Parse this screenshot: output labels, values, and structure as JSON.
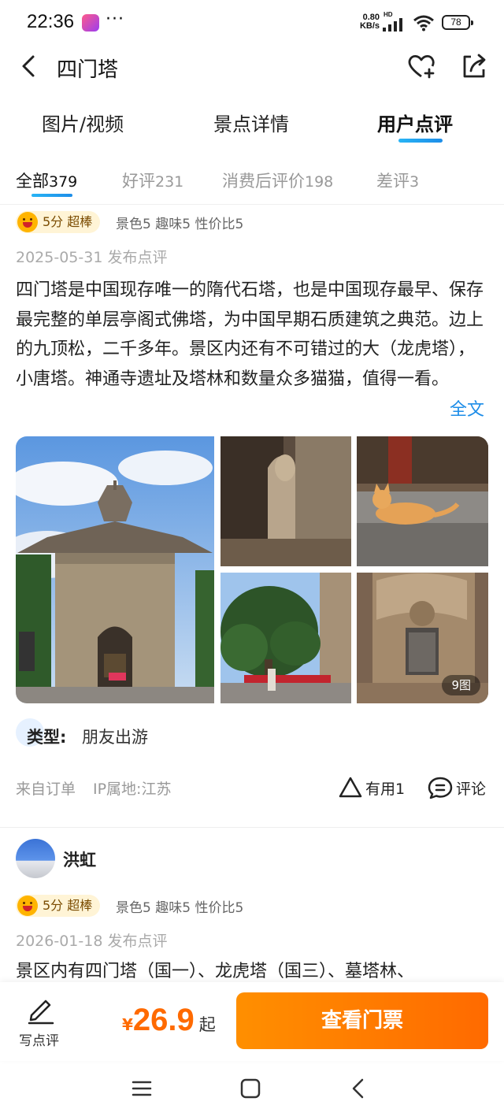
{
  "status_bar": {
    "time": "22:36",
    "dots": "···",
    "network_speed_value": "0.80",
    "network_speed_unit": "KB/s",
    "hd": "HD",
    "battery": "78"
  },
  "header": {
    "title": "四门塔",
    "back_icon": "chevron-left-icon",
    "favorite_icon": "heart-plus-icon",
    "share_icon": "share-icon"
  },
  "main_tabs": [
    {
      "label": "图片/视频",
      "active": false
    },
    {
      "label": "景点详情",
      "active": false
    },
    {
      "label": "用户点评",
      "active": true
    }
  ],
  "filter_tabs": [
    {
      "label": "全部",
      "count": "379",
      "active": true
    },
    {
      "label": "好评",
      "count": "231",
      "active": false
    },
    {
      "label": "消费后评价",
      "count": "198",
      "active": false
    },
    {
      "label": "差评",
      "count": "3",
      "active": false
    }
  ],
  "review1": {
    "score": "5分 超棒",
    "sub_scores": "景色5 趣味5 性价比5",
    "date": "2025-05-31 发布点评",
    "text": "四门塔是中国现存唯一的隋代石塔，也是中国现存最早、保存最完整的单层亭阁式佛塔，为中国早期石质建筑之典范。边上的九顶松，二千多年。景区内还有不可错过的大（龙虎塔），小唐塔。神通寺遗址及塔林和数量众多猫猫，值得一看。",
    "more_link": "全文",
    "photo_count": "9图",
    "trip_type_label": "类型:",
    "trip_type_value": "朋友出游",
    "source": "来自订单",
    "ip": "IP属地:江苏",
    "useful": "有用1",
    "comment": "评论"
  },
  "review2": {
    "username": "洪虹",
    "score": "5分 超棒",
    "sub_scores": "景色5 趣味5 性价比5",
    "date": "2026-01-18 发布点评",
    "text": "景区内有四门塔（国一）、龙虎塔（国三）、墓塔林、"
  },
  "bottom_bar": {
    "write_label": "写点评",
    "currency": "¥",
    "price": "26.9",
    "price_suffix": "起",
    "buy_label": "查看门票"
  },
  "colors": {
    "accent_blue": "#1d8de8",
    "price_orange": "#ff6a00",
    "score_pill_bg": "#fff4d6"
  }
}
